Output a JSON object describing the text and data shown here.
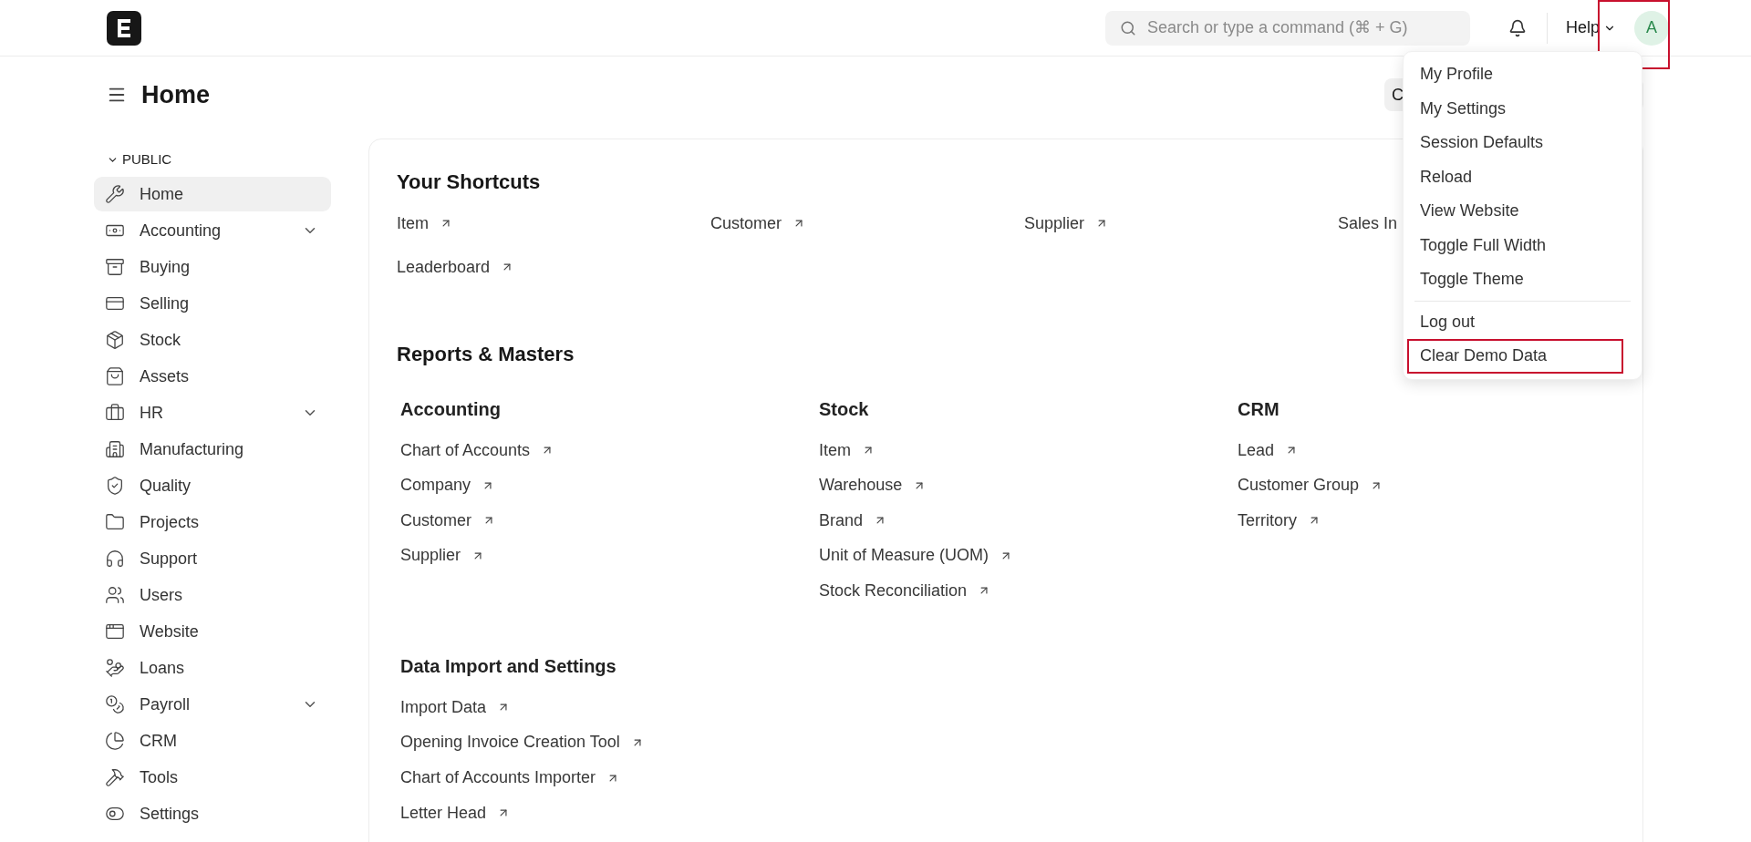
{
  "topbar": {
    "search": {
      "placeholder": "Search or type a command (⌘ + G)"
    },
    "help": "Help",
    "avatar": "A",
    "avatar_highlighted": true
  },
  "page": {
    "title": "Home",
    "hidden_button": "C"
  },
  "sidebar": {
    "section": "PUBLIC",
    "expanded": true,
    "items": [
      {
        "label": "Home",
        "selected": true,
        "expandable": false
      },
      {
        "label": "Accounting",
        "selected": false,
        "expandable": true
      },
      {
        "label": "Buying",
        "selected": false,
        "expandable": false
      },
      {
        "label": "Selling",
        "selected": false,
        "expandable": false
      },
      {
        "label": "Stock",
        "selected": false,
        "expandable": false
      },
      {
        "label": "Assets",
        "selected": false,
        "expandable": false
      },
      {
        "label": "HR",
        "selected": false,
        "expandable": true
      },
      {
        "label": "Manufacturing",
        "selected": false,
        "expandable": false
      },
      {
        "label": "Quality",
        "selected": false,
        "expandable": false
      },
      {
        "label": "Projects",
        "selected": false,
        "expandable": false
      },
      {
        "label": "Support",
        "selected": false,
        "expandable": false
      },
      {
        "label": "Users",
        "selected": false,
        "expandable": false
      },
      {
        "label": "Website",
        "selected": false,
        "expandable": false
      },
      {
        "label": "Loans",
        "selected": false,
        "expandable": false
      },
      {
        "label": "Payroll",
        "selected": false,
        "expandable": true
      },
      {
        "label": "CRM",
        "selected": false,
        "expandable": false
      },
      {
        "label": "Tools",
        "selected": false,
        "expandable": false
      },
      {
        "label": "Settings",
        "selected": false,
        "expandable": false
      }
    ]
  },
  "shortcuts": {
    "title": "Your Shortcuts",
    "items": [
      {
        "label": "Item",
        "arrow": true
      },
      {
        "label": "Customer",
        "arrow": true
      },
      {
        "label": "Supplier",
        "arrow": true
      },
      {
        "label": "Sales In",
        "arrow": false
      },
      {
        "label": "Leaderboard",
        "arrow": true
      }
    ]
  },
  "reports": {
    "title": "Reports & Masters",
    "cards": [
      {
        "title": "Accounting",
        "links": [
          "Chart of Accounts",
          "Company",
          "Customer",
          "Supplier"
        ]
      },
      {
        "title": "Stock",
        "links": [
          "Item",
          "Warehouse",
          "Brand",
          "Unit of Measure (UOM)",
          "Stock Reconciliation"
        ]
      },
      {
        "title": "CRM",
        "links": [
          "Lead",
          "Customer Group",
          "Territory"
        ]
      },
      {
        "title": "Data Import and Settings",
        "links": [
          "Import Data",
          "Opening Invoice Creation Tool",
          "Chart of Accounts Importer",
          "Letter Head"
        ]
      }
    ]
  },
  "user_menu": {
    "groups": [
      [
        {
          "label": "My Profile",
          "highlighted": false
        },
        {
          "label": "My Settings",
          "highlighted": false
        },
        {
          "label": "Session Defaults",
          "highlighted": false
        },
        {
          "label": "Reload",
          "highlighted": false
        },
        {
          "label": "View Website",
          "highlighted": false
        },
        {
          "label": "Toggle Full Width",
          "highlighted": false
        },
        {
          "label": "Toggle Theme",
          "highlighted": false
        }
      ],
      [
        {
          "label": "Log out",
          "highlighted": false
        },
        {
          "label": "Clear Demo Data",
          "highlighted": true
        }
      ]
    ]
  }
}
